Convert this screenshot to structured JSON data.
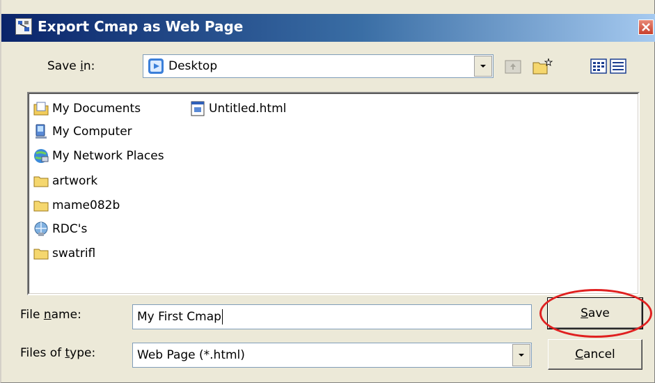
{
  "window": {
    "title": "Export Cmap as Web Page"
  },
  "save_in": {
    "label_pre": "Save ",
    "label_accel": "i",
    "label_post": "n:",
    "value": "Desktop"
  },
  "toolbar": {
    "up_icon": "up-folder-icon",
    "new_folder_icon": "new-folder-icon",
    "view_icon": "view-menu-icon"
  },
  "files": [
    {
      "name": "My Documents",
      "icon": "my-documents-icon"
    },
    {
      "name": "My Computer",
      "icon": "computer-icon"
    },
    {
      "name": "My Network Places",
      "icon": "network-places-icon"
    },
    {
      "name": "artwork",
      "icon": "folder-icon"
    },
    {
      "name": "mame082b",
      "icon": "folder-icon"
    },
    {
      "name": "RDC's",
      "icon": "network-drive-icon"
    },
    {
      "name": "swatrifl",
      "icon": "folder-icon"
    },
    {
      "name": "Untitled.html",
      "icon": "html-file-icon"
    }
  ],
  "file_name": {
    "label_pre": "File ",
    "label_accel": "n",
    "label_post": "ame:",
    "value": "My First Cmap"
  },
  "file_type": {
    "label_pre": "Files of ",
    "label_accel": "t",
    "label_post": "ype:",
    "value": "Web Page (*.html)"
  },
  "buttons": {
    "save_accel": "S",
    "save_rest": "ave",
    "cancel_accel": "C",
    "cancel_rest": "ancel"
  },
  "colors": {
    "highlight": "#e02020",
    "title_bar": "#0a246a"
  }
}
